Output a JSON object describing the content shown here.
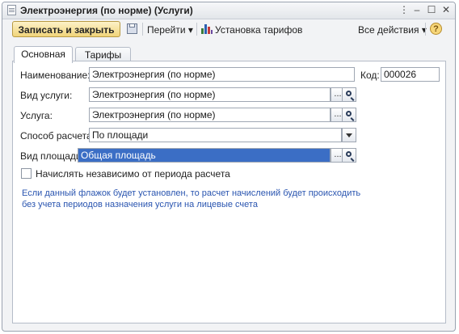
{
  "window": {
    "title": "Электроэнергия (по норме) (Услуги)"
  },
  "window_controls": {
    "options": "⋮",
    "minimize": "–",
    "maximize": "☐",
    "close": "✕"
  },
  "toolbar": {
    "save_close_label": "Записать и закрыть",
    "goto_label": "Перейти",
    "tariffs_label": "Установка тарифов",
    "all_actions_label": "Все действия",
    "dropdown_glyph": "▾",
    "help_label": "?"
  },
  "tabs": [
    {
      "label": "Основная",
      "active": true
    },
    {
      "label": "Тарифы",
      "active": false
    }
  ],
  "form": {
    "name_label": "Наименование:",
    "name_value": "Электроэнергия (по норме)",
    "code_label": "Код:",
    "code_value": "000026",
    "service_type_label": "Вид услуги:",
    "service_type_value": "Электроэнергия (по норме)",
    "service_label": "Услуга:",
    "service_value": "Электроэнергия (по норме)",
    "calc_method_label": "Способ расчета:",
    "calc_method_value": "По площади",
    "area_type_label": "Вид площади:",
    "area_type_value": "Общая площадь",
    "select_button": "...",
    "checkbox_label": "Начислять независимо от периода расчета",
    "checkbox_checked": false,
    "hint_text": "Если данный флажок будет установлен, то расчет начислений будет происходить без учета периодов назначения услуги на лицевые счета"
  },
  "colors": {
    "accent": "#f0d47a",
    "selection": "#3b6ec5",
    "hint": "#2a55b0"
  }
}
